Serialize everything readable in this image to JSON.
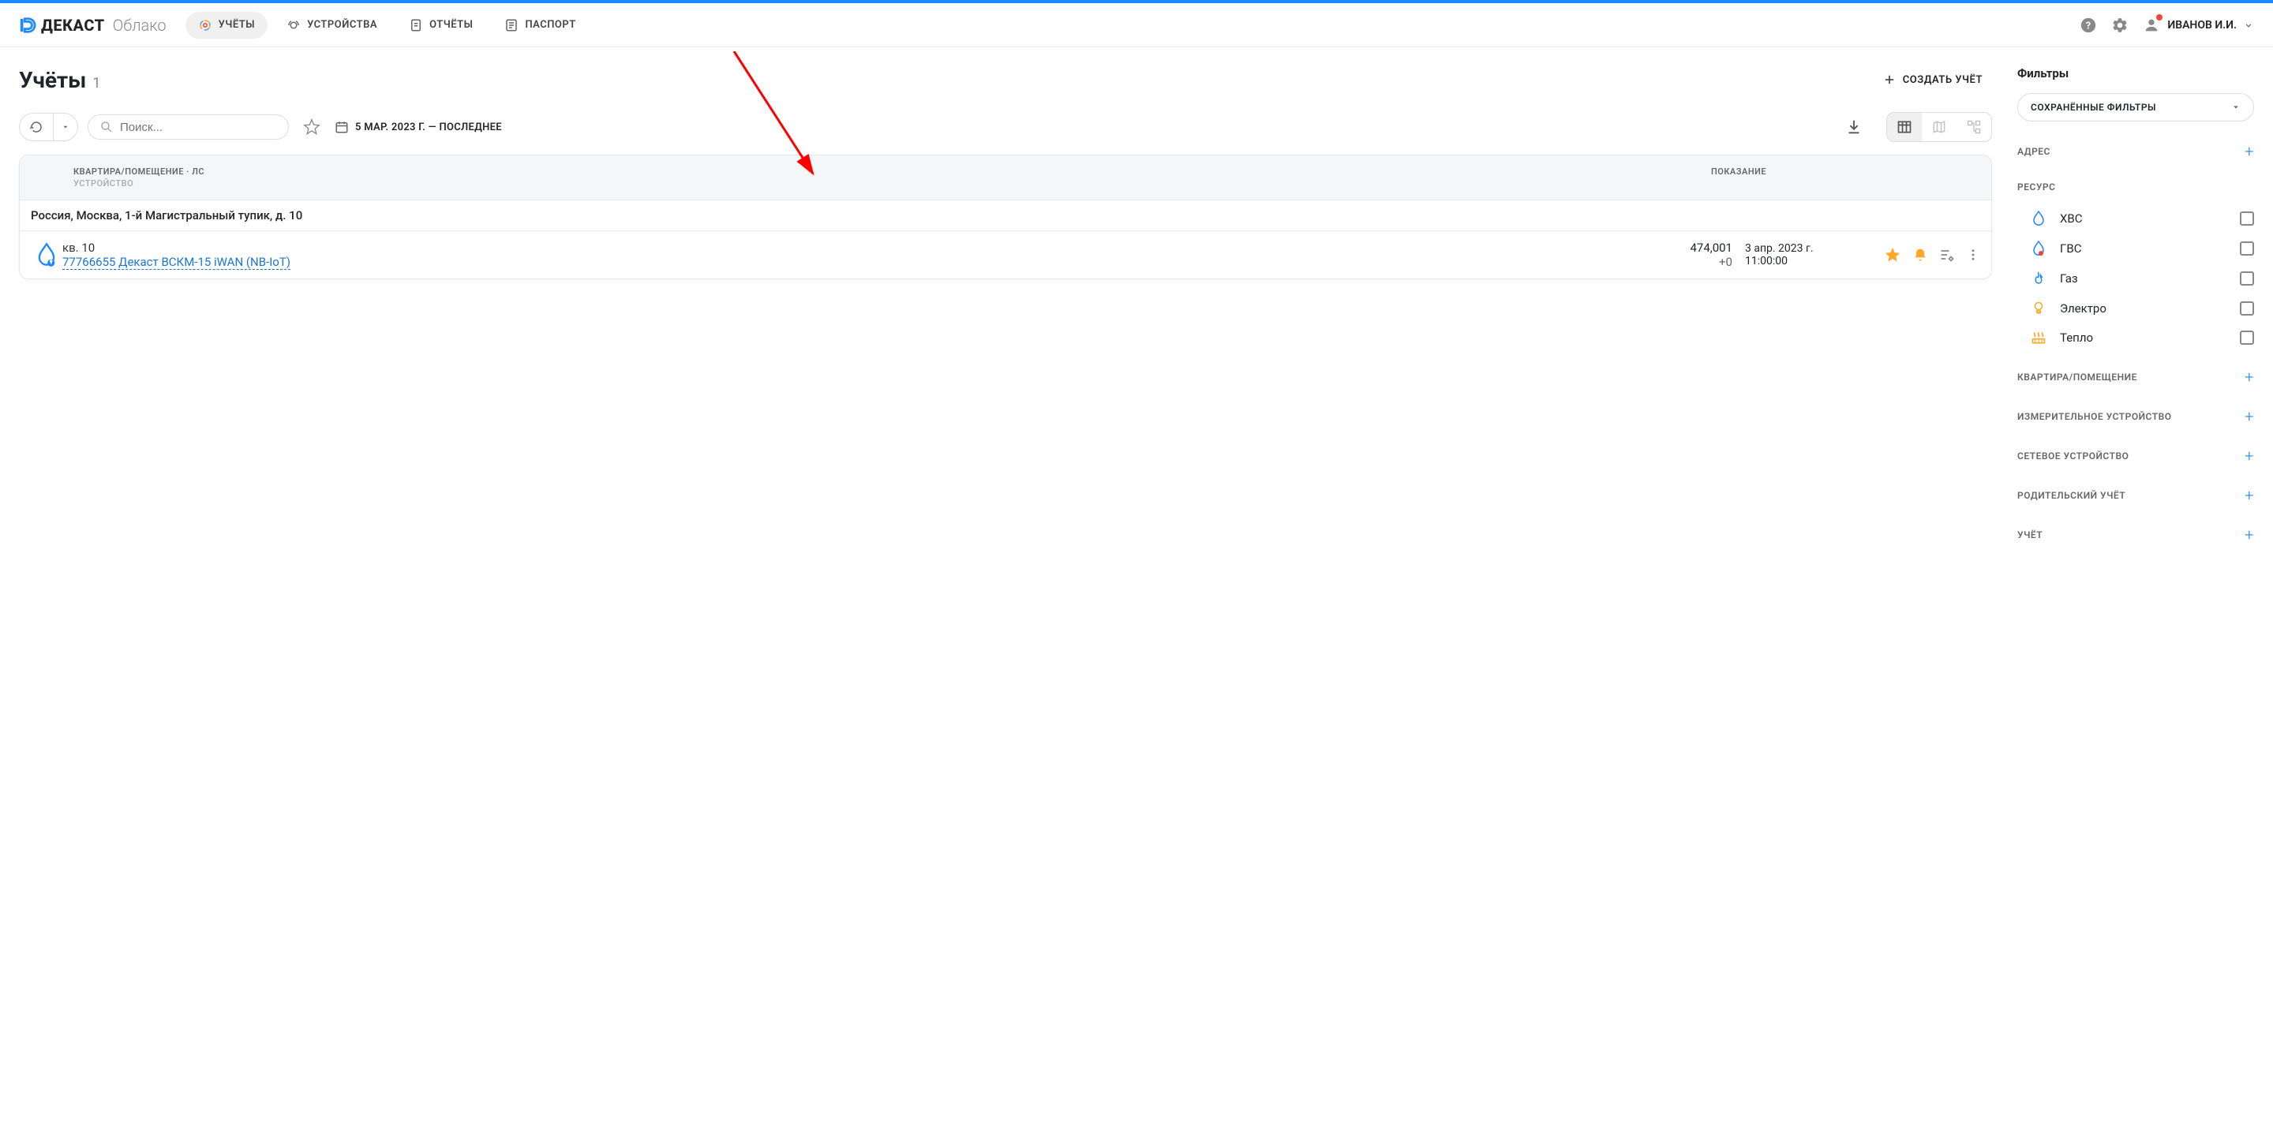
{
  "brand": {
    "name": "ДЕКАСТ",
    "suffix": "Облако"
  },
  "nav": {
    "uchety": "УЧЁТЫ",
    "ustroystva": "УСТРОЙСТВА",
    "otchety": "ОТЧЁТЫ",
    "passport": "ПАСПОРТ"
  },
  "user": {
    "name": "ИВАНОВ И.И."
  },
  "page": {
    "title": "Учёты",
    "count": "1",
    "create_btn": "СОЗДАТЬ УЧЁТ"
  },
  "toolbar": {
    "search_placeholder": "Поиск...",
    "date_range": "5 МАР. 2023 Г. — ПОСЛЕДНЕЕ"
  },
  "table": {
    "header_left_1": "КВАРТИРА/ПОМЕЩЕНИЕ · ЛС",
    "header_left_2": "УСТРОЙСТВО",
    "header_right": "ПОКАЗАНИЕ",
    "group_address": "Россия, Москва, 1-й Магистральный тупик, д. 10",
    "row": {
      "apartment": "кв. 10",
      "device": "77766655 Декаст ВСКМ-15 iWAN (NB-IoT)",
      "reading": "474,001",
      "delta": "+0",
      "date": "3 апр. 2023 г.",
      "time": "11:00:00"
    }
  },
  "filters": {
    "title": "Фильтры",
    "saved": "СОХРАНЁННЫЕ ФИЛЬТРЫ",
    "address": "АДРЕС",
    "resource": "РЕСУРС",
    "resources": {
      "hvs": "ХВС",
      "gvs": "ГВС",
      "gas": "Газ",
      "electro": "Электро",
      "teplo": "Тепло"
    },
    "apartment": "КВАРТИРА/ПОМЕЩЕНИЕ",
    "meter_device": "ИЗМЕРИТЕЛЬНОЕ УСТРОЙСТВО",
    "net_device": "СЕТЕВОЕ УСТРОЙСТВО",
    "parent": "РОДИТЕЛЬСКИЙ УЧЁТ",
    "uchet": "УЧЁТ"
  }
}
